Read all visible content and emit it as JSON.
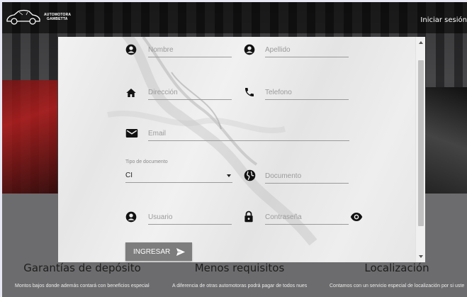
{
  "brand": {
    "line1": "AUTOMOTORA",
    "line2": "GAMBETTA"
  },
  "nav": {
    "login": "Iniciar sesión"
  },
  "form": {
    "first_name_placeholder": "Nombre",
    "last_name_placeholder": "Apellido",
    "address_placeholder": "Dirección",
    "phone_placeholder": "Telefono",
    "email_placeholder": "Email",
    "doc_type_label": "Tipo de documento",
    "doc_type_value": "CI",
    "document_placeholder": "Documento",
    "user_placeholder": "Usuario",
    "password_placeholder": "Contraseña",
    "submit_label": "INGRESAR"
  },
  "features": [
    {
      "title": "Garantías de depósito",
      "text": "Montos bajos donde además contará con beneficios especiales. Descuentos, regalos"
    },
    {
      "title": "Menos requisitos",
      "text": "A diferencia de otras automotoras podrá pagar de todos nuestros autos con los"
    },
    {
      "title": "Localización",
      "text": "Contamos con un servicio especial de localización por si usted podrá solicitar su"
    }
  ]
}
